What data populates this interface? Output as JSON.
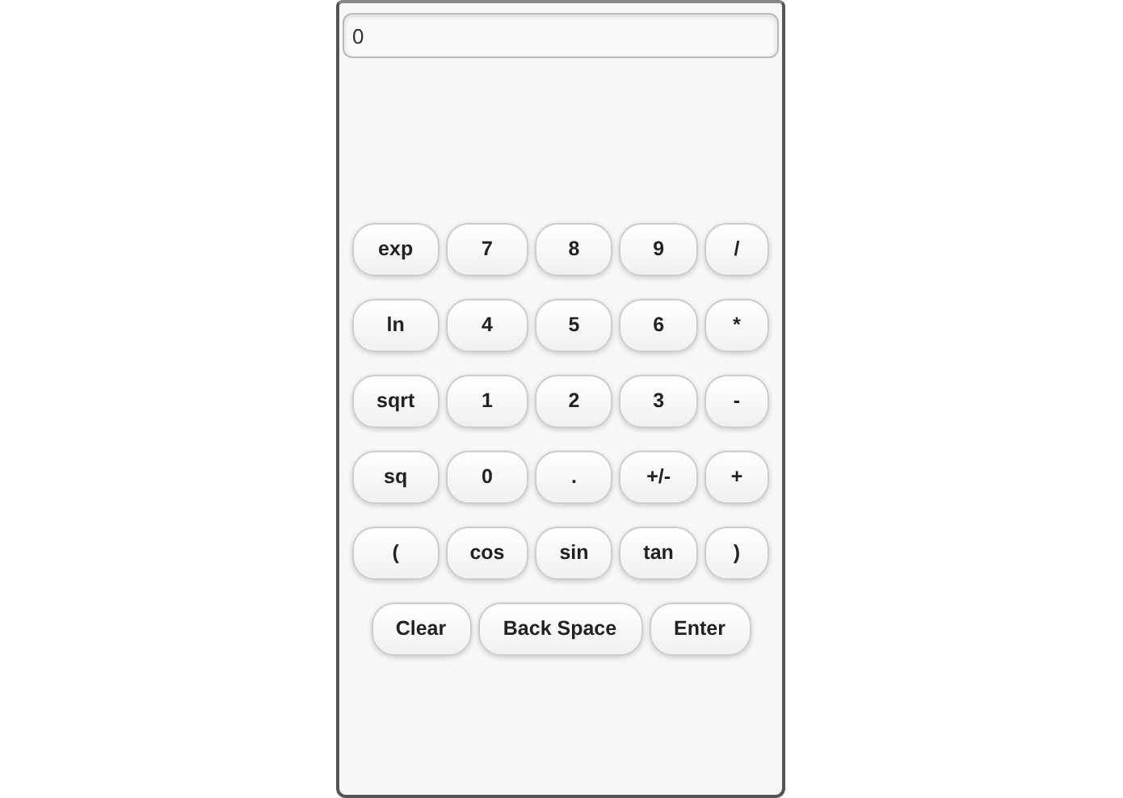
{
  "display": {
    "value": "0"
  },
  "keypad": [
    [
      "exp",
      "7",
      "8",
      "9",
      "/"
    ],
    [
      "ln",
      "4",
      "5",
      "6",
      "*"
    ],
    [
      "sqrt",
      "1",
      "2",
      "3",
      "-"
    ],
    [
      "sq",
      "0",
      ".",
      "+/-",
      "+"
    ],
    [
      "(",
      "cos",
      "sin",
      "tan",
      ")"
    ]
  ],
  "actions": [
    "Clear",
    "Back Space",
    "Enter"
  ]
}
